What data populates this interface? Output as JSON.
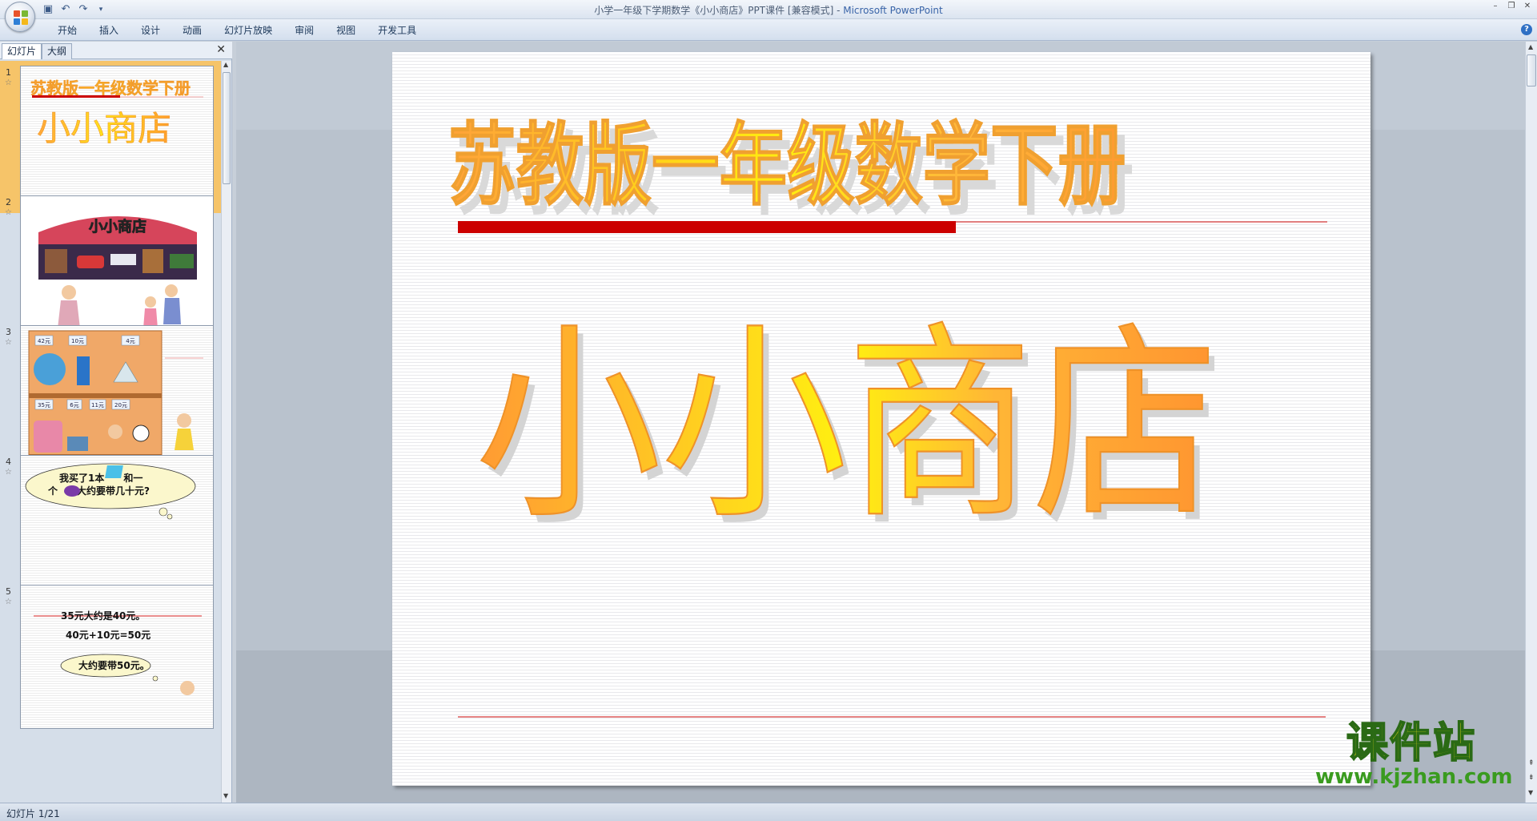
{
  "window": {
    "title": "小学一年级下学期数学《小小商店》PPT课件 [兼容模式]",
    "title_separator": " - ",
    "app_name": "Microsoft PowerPoint"
  },
  "ribbon": {
    "tabs": [
      "开始",
      "插入",
      "设计",
      "动画",
      "幻灯片放映",
      "审阅",
      "视图",
      "开发工具"
    ]
  },
  "left_pane": {
    "tabs": [
      "幻灯片",
      "大纲"
    ],
    "thumbnails": [
      {
        "num": "1",
        "title_line": "苏教版一年级数学下册",
        "main_text": "小小商店"
      },
      {
        "num": "2",
        "sign_text": "小小商店"
      },
      {
        "num": "3",
        "prices_top": [
          "42元",
          "10元",
          "4元"
        ],
        "prices_bottom": [
          "35元",
          "6元",
          "11元",
          "20元"
        ]
      },
      {
        "num": "4",
        "bubble_line1": "我买了1本　　和一",
        "bubble_line2": "个　　大约要带几十元?"
      },
      {
        "num": "5",
        "line1": "35元大约是40元。",
        "line2": "40元+10元=50元",
        "line3": "大约要带50元。"
      }
    ]
  },
  "slide": {
    "subtitle": "苏教版一年级数学下册",
    "title": "小小商店"
  },
  "status": {
    "slide_info": "幻灯片 1/21"
  },
  "watermark": {
    "title": "课件站",
    "url": "www.kjzhan.com"
  },
  "colors": {
    "title_gradient_start": "#ffb43c",
    "title_gradient_mid": "#ffe600",
    "rule_red": "#cc0000",
    "selected_thumb": "#f6c469"
  }
}
